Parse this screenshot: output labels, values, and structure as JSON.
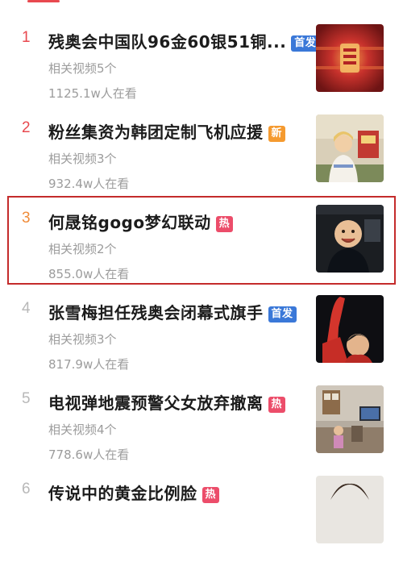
{
  "trending_list": {
    "items": [
      {
        "rank": "1",
        "title": "残奥会中国队96金60银51铜...",
        "badge": "首发",
        "related_videos": "相关视频5个",
        "viewers": "1125.1w人在看"
      },
      {
        "rank": "2",
        "title": "粉丝集资为韩团定制飞机应援",
        "badge": "新",
        "related_videos": "相关视频3个",
        "viewers": "932.4w人在看"
      },
      {
        "rank": "3",
        "title": "何晟铭gogo梦幻联动",
        "badge": "热",
        "related_videos": "相关视频2个",
        "viewers": "855.0w人在看"
      },
      {
        "rank": "4",
        "title": "张雪梅担任残奥会闭幕式旗手",
        "badge": "首发",
        "related_videos": "相关视频3个",
        "viewers": "817.9w人在看"
      },
      {
        "rank": "5",
        "title": "电视弹地震预警父女放弃撤离",
        "badge": "热",
        "related_videos": "相关视频4个",
        "viewers": "778.6w人在看"
      },
      {
        "rank": "6",
        "title": "传说中的黄金比例脸",
        "badge": "热",
        "related_videos": "",
        "viewers": ""
      }
    ]
  },
  "colors": {
    "accent_red": "#e8494f",
    "rank_orange": "#f08c3a",
    "rank_gray": "#b8b8b8",
    "badge_first": "#3a78d8",
    "badge_new": "#f59a2f",
    "badge_hot": "#ec4d6a",
    "highlight_border": "#c42b2b"
  }
}
